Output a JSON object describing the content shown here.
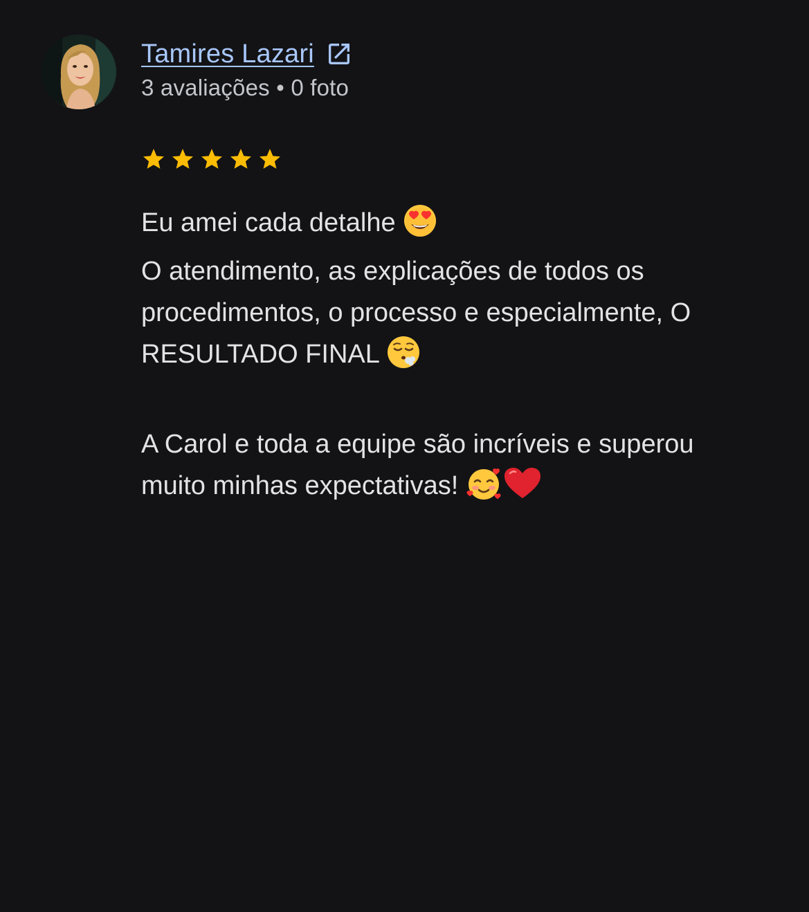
{
  "reviewer": {
    "name": "Tamires Lazari",
    "meta": "3 avaliações • 0 foto",
    "rating": 5,
    "rating_max": 5
  },
  "review": {
    "line1": "Eu amei cada detalhe",
    "line2": "O atendimento, as explicações de todos os",
    "line3": "procedimentos, o processo e especialmente, O",
    "line4": "RESULTADO FINAL",
    "line5": "A Carol e toda a equipe são incríveis e superou",
    "line6": "muito minhas expectativas!"
  },
  "icons": {
    "external_link": "open-in-new-icon",
    "star": "star-icon",
    "emoji_1": "heart-eyes-emoji-icon",
    "emoji_2": "relieved-sigh-emoji-icon",
    "emoji_3": "smiling-face-with-hearts-emoji-icon",
    "emoji_4": "red-heart-emoji-icon"
  },
  "colors": {
    "background": "#131316",
    "link": "#a8c7fa",
    "star": "#fbbc04",
    "text": "#e3e3e6",
    "muted": "#c4c6cc"
  }
}
